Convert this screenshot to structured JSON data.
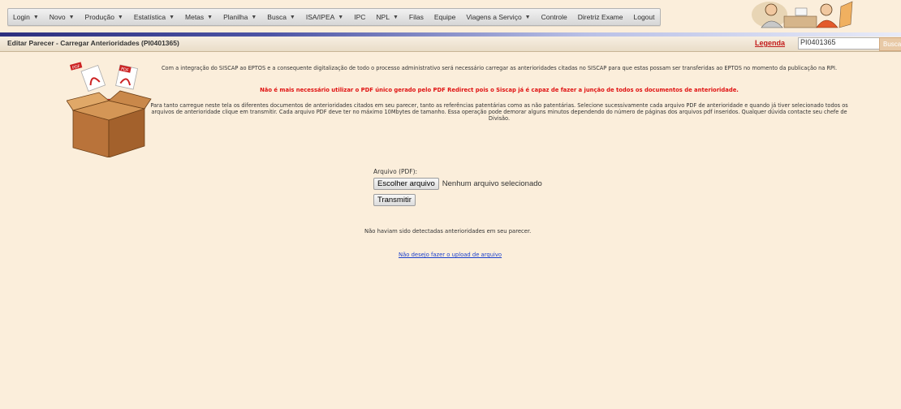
{
  "menu": {
    "items": [
      {
        "label": "Login",
        "dropdown": true
      },
      {
        "label": "Novo",
        "dropdown": true
      },
      {
        "label": "Produção",
        "dropdown": true
      },
      {
        "label": "Estatística",
        "dropdown": true
      },
      {
        "label": "Metas",
        "dropdown": true
      },
      {
        "label": "Planilha",
        "dropdown": true
      },
      {
        "label": "Busca",
        "dropdown": true
      },
      {
        "label": "ISA/IPEA",
        "dropdown": true
      },
      {
        "label": "IPC",
        "dropdown": false
      },
      {
        "label": "NPL",
        "dropdown": true
      },
      {
        "label": "Filas",
        "dropdown": false
      },
      {
        "label": "Equipe",
        "dropdown": false
      },
      {
        "label": "Viagens a Serviço",
        "dropdown": true
      },
      {
        "label": "Controle",
        "dropdown": false
      },
      {
        "label": "Diretriz Exame",
        "dropdown": false
      },
      {
        "label": "Logout",
        "dropdown": false
      }
    ],
    "dropdown_glyph": "▼"
  },
  "title_bar": {
    "page_title": "Editar Parecer - Carregar Anterioridades (PI0401365)",
    "legend_label": "Legenda",
    "legend_value": "PI0401365",
    "search_label": "Busca"
  },
  "info": {
    "paragraph_1": "Com a integração do SISCAP ao EPTOS e a consequente digitalização de todo o processo administrativo será necessário carregar as anterioridades citadas no SISCAP para que estas possam ser transferidas ao EPTOS no momento da publicação na RPI.",
    "paragraph_2": "Não é mais necessário utilizar o PDF único gerado pelo PDF Redirect pois o Siscap já é capaz de fazer a junção de todos os documentos de anterioridade.",
    "paragraph_3": "Para tanto carregue neste tela os diferentes documentos de anterioridades citados em seu parecer, tanto as referências patentárias como as não patentárias. Selecione sucessivamente cada arquivo PDF de anterioridade e quando já tiver selecionado todos os arquivos de anterioridade clique em transmitir. Cada arquivo PDF deve ter no máximo 10Mbytes de tamanho. Essa operação pode demorar alguns minutos dependendo do número de páginas dos arquivos pdf inseridos. Qualquer dúvida contacte seu chefe de Divisão."
  },
  "upload": {
    "file_label": "Arquivo (PDF):",
    "choose_button": "Escolher arquivo",
    "file_status": "Nenhum arquivo selecionado",
    "transmit_button": "Transmitir"
  },
  "status": {
    "no_prior_message": "Não haviam sido detectadas anterioridades em seu parecer.",
    "skip_link": "Não desejo fazer o upload de arquivo"
  },
  "illustration": {
    "pdf_badge": "PDF"
  },
  "colors": {
    "background": "#fbeedb",
    "warning_text": "#e01111",
    "link": "#1a3fcc",
    "legend_link": "#c21a1a",
    "nav_underline": "#2c2f7e"
  }
}
